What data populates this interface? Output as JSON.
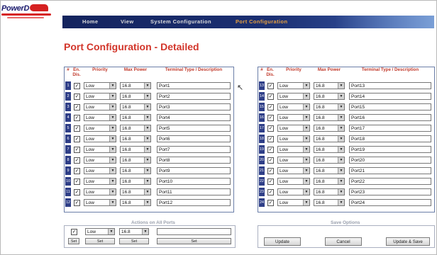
{
  "logo": {
    "text": "PowerD"
  },
  "nav": [
    {
      "label": "Home"
    },
    {
      "label": "View"
    },
    {
      "label": "System Configuration"
    },
    {
      "label": "Port Configuration"
    }
  ],
  "page_title": "Port Configuration - Detailed",
  "columns": {
    "num": "#",
    "en": "En. Dis.",
    "priority": "Priority",
    "power": "Max Power",
    "desc": "Terminal Type / Description"
  },
  "ports_left": [
    {
      "num": "1",
      "priority": "Low",
      "power": "16.8",
      "desc": "Port1"
    },
    {
      "num": "2",
      "priority": "Low",
      "power": "16.8",
      "desc": "Port2"
    },
    {
      "num": "3",
      "priority": "Low",
      "power": "16.8",
      "desc": "Port3"
    },
    {
      "num": "4",
      "priority": "Low",
      "power": "16.8",
      "desc": "Port4"
    },
    {
      "num": "5",
      "priority": "Low",
      "power": "16.8",
      "desc": "Port5"
    },
    {
      "num": "6",
      "priority": "Low",
      "power": "16.8",
      "desc": "Port6"
    },
    {
      "num": "7",
      "priority": "Low",
      "power": "16.8",
      "desc": "Port7"
    },
    {
      "num": "8",
      "priority": "Low",
      "power": "16.8",
      "desc": "Port8"
    },
    {
      "num": "9",
      "priority": "Low",
      "power": "16.8",
      "desc": "Port9"
    },
    {
      "num": "10",
      "priority": "Low",
      "power": "16.8",
      "desc": "Port10"
    },
    {
      "num": "11",
      "priority": "Low",
      "power": "16.8",
      "desc": "Port11"
    },
    {
      "num": "12",
      "priority": "Low",
      "power": "16.8",
      "desc": "Port12"
    }
  ],
  "ports_right": [
    {
      "num": "13",
      "priority": "Low",
      "power": "16.8",
      "desc": "Port13"
    },
    {
      "num": "14",
      "priority": "Low",
      "power": "16.8",
      "desc": "Port14"
    },
    {
      "num": "15",
      "priority": "Low",
      "power": "16.8",
      "desc": "Port15"
    },
    {
      "num": "16",
      "priority": "Low",
      "power": "16.8",
      "desc": "Port16"
    },
    {
      "num": "17",
      "priority": "Low",
      "power": "16.8",
      "desc": "Port17"
    },
    {
      "num": "18",
      "priority": "Low",
      "power": "16.8",
      "desc": "Port18"
    },
    {
      "num": "19",
      "priority": "Low",
      "power": "16.8",
      "desc": "Port19"
    },
    {
      "num": "20",
      "priority": "Low",
      "power": "16.8",
      "desc": "Port20"
    },
    {
      "num": "21",
      "priority": "Low",
      "power": "16.8",
      "desc": "Port21"
    },
    {
      "num": "22",
      "priority": "Low",
      "power": "16.8",
      "desc": "Port22"
    },
    {
      "num": "23",
      "priority": "Low",
      "power": "16.8",
      "desc": "Port23"
    },
    {
      "num": "24",
      "priority": "Low",
      "power": "16.8",
      "desc": "Port24"
    }
  ],
  "actions": {
    "title": "Actions on All Ports",
    "priority": "Low",
    "power": "16.8",
    "desc": "",
    "set_label": "Set"
  },
  "save": {
    "title": "Save Options",
    "update": "Update",
    "cancel": "Cancel",
    "update_save": "Update & Save"
  },
  "colors": {
    "title": "#d2352a",
    "header_text": "#c0392b",
    "num_cell": "#2f3f88",
    "nav_bg": "#14245e",
    "nav_active": "#e8a040"
  }
}
